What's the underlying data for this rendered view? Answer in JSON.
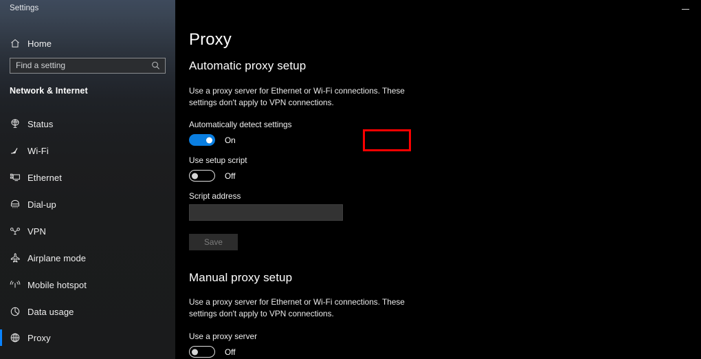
{
  "window": {
    "title": "Settings",
    "minimize_label": "Minimize",
    "accent_color": "#0a84ff",
    "highlight_color": "#ff0000"
  },
  "sidebar": {
    "home": {
      "label": "Home",
      "icon": "home-icon"
    },
    "search": {
      "placeholder": "Find a setting",
      "value": "",
      "icon": "search-icon"
    },
    "section_title": "Network & Internet",
    "items": [
      {
        "label": "Status",
        "icon": "status-icon",
        "selected": false
      },
      {
        "label": "Wi-Fi",
        "icon": "wifi-icon",
        "selected": false
      },
      {
        "label": "Ethernet",
        "icon": "ethernet-icon",
        "selected": false
      },
      {
        "label": "Dial-up",
        "icon": "dialup-icon",
        "selected": false
      },
      {
        "label": "VPN",
        "icon": "vpn-icon",
        "selected": false
      },
      {
        "label": "Airplane mode",
        "icon": "airplane-icon",
        "selected": false
      },
      {
        "label": "Mobile hotspot",
        "icon": "hotspot-icon",
        "selected": false
      },
      {
        "label": "Data usage",
        "icon": "data-usage-icon",
        "selected": false
      },
      {
        "label": "Proxy",
        "icon": "globe-icon",
        "selected": true
      }
    ]
  },
  "main": {
    "page_title": "Proxy",
    "automatic": {
      "heading": "Automatic proxy setup",
      "description": "Use a proxy server for Ethernet or Wi-Fi connections. These settings don't apply to VPN connections.",
      "auto_detect": {
        "label": "Automatically detect settings",
        "state": "On",
        "on": true
      },
      "setup_script": {
        "label": "Use setup script",
        "state": "Off",
        "on": false
      },
      "script_address": {
        "label": "Script address",
        "value": "",
        "placeholder": ""
      },
      "save_label": "Save"
    },
    "manual": {
      "heading": "Manual proxy setup",
      "description": "Use a proxy server for Ethernet or Wi-Fi connections. These settings don't apply to VPN connections.",
      "use_proxy": {
        "label": "Use a proxy server",
        "state": "Off",
        "on": false
      }
    }
  }
}
